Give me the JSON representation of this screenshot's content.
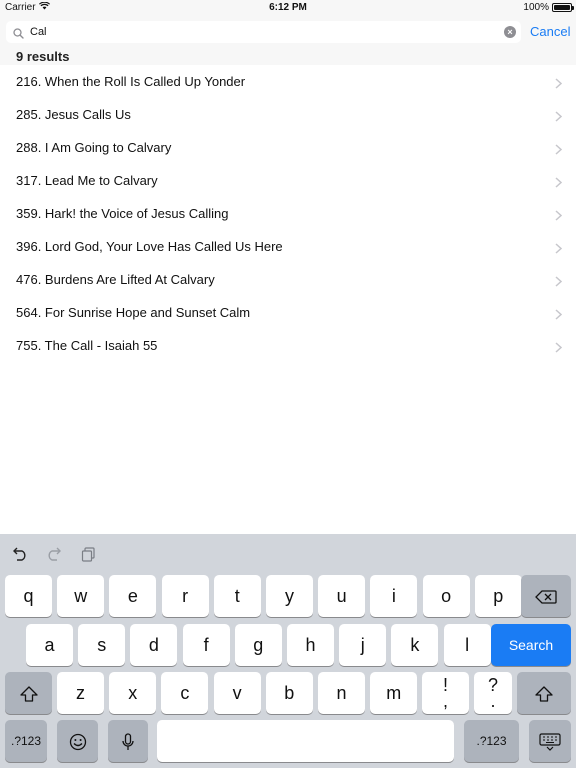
{
  "status_bar": {
    "carrier": "Carrier",
    "time": "6:12 PM",
    "battery": "100%",
    "battery_level": 1.0
  },
  "search": {
    "query": "Cal",
    "cancel_label": "Cancel"
  },
  "results": {
    "count_label": "9 results",
    "items": [
      "216. When the Roll Is Called Up Yonder",
      "285. Jesus Calls Us",
      "288. I Am Going to Calvary",
      "317. Lead Me to Calvary",
      "359. Hark! the Voice of Jesus Calling",
      "396. Lord God, Your Love Has Called Us Here",
      "476. Burdens Are Lifted At Calvary",
      "564. For Sunrise Hope and Sunset Calm",
      "755. The Call - Isaiah 55"
    ]
  },
  "keyboard": {
    "row1": [
      "q",
      "w",
      "e",
      "r",
      "t",
      "y",
      "u",
      "i",
      "o",
      "p"
    ],
    "row2": [
      "a",
      "s",
      "d",
      "f",
      "g",
      "h",
      "j",
      "k",
      "l"
    ],
    "row3": [
      "z",
      "x",
      "c",
      "v",
      "b",
      "n",
      "m"
    ],
    "punct_left": [
      "!",
      ","
    ],
    "punct_right": [
      "?",
      "."
    ],
    "search_label": "Search",
    "numbers_label": ".?123",
    "icons": [
      "undo-icon",
      "redo-icon",
      "paste-icon",
      "delete-icon",
      "shift-icon",
      "emoji-icon",
      "microphone-icon",
      "keyboard-dismiss-icon"
    ]
  },
  "colors": {
    "accent": "#1a7cf4",
    "bar_bg": "#f7f7f7",
    "keyboard_bg": "#d1d5db",
    "function_key": "#adb3bc"
  }
}
